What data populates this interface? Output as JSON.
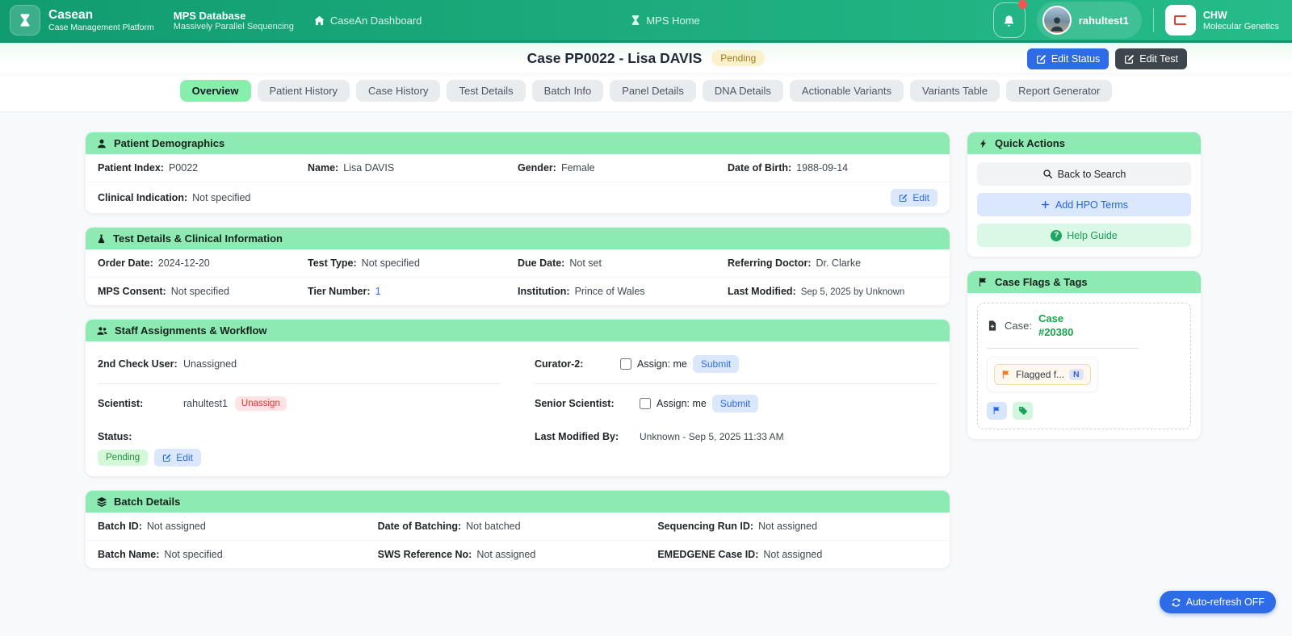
{
  "colors": {
    "brand_green_dark": "#119c6f",
    "brand_green_light": "#27bb8a",
    "header_green": "#8deab2",
    "active_tab": "#86efac",
    "accent_blue": "#2e6be6",
    "pending_bg": "#fbf2cd",
    "pending_text": "#9a7c1f",
    "danger_red": "#e03131",
    "success_green": "#16a34a"
  },
  "navbar": {
    "brand_title": "Casean",
    "brand_subtitle": "Case Management Platform",
    "mps_title": "MPS Database",
    "mps_subtitle": "Massively Parallel Sequencing",
    "dashboard_link": "CaseAn Dashboard",
    "home_link": "MPS Home",
    "user_name": "rahultest1",
    "org_title": "CHW",
    "org_subtitle": "Molecular Genetics"
  },
  "header": {
    "title": "Case PP0022 - Lisa DAVIS",
    "status": "Pending",
    "edit_status_label": "Edit Status",
    "edit_test_label": "Edit Test"
  },
  "tabs": [
    "Overview",
    "Patient History",
    "Case History",
    "Test Details",
    "Batch Info",
    "Panel Details",
    "DNA Details",
    "Actionable Variants",
    "Variants Table",
    "Report Generator"
  ],
  "demographics": {
    "title": "Patient Demographics",
    "row1": [
      {
        "label": "Patient Index:",
        "value": "P0022"
      },
      {
        "label": "Name:",
        "value": "Lisa DAVIS"
      },
      {
        "label": "Gender:",
        "value": "Female"
      },
      {
        "label": "Date of Birth:",
        "value": "1988-09-14"
      }
    ],
    "row2": {
      "label": "Clinical Indication:",
      "value": "Not specified"
    },
    "edit_label": "Edit"
  },
  "test_details": {
    "title": "Test Details & Clinical Information",
    "row1": [
      {
        "label": "Order Date:",
        "value": "2024-12-20"
      },
      {
        "label": "Test Type:",
        "value": "Not specified"
      },
      {
        "label": "Due Date:",
        "value": "Not set"
      },
      {
        "label": "Referring Doctor:",
        "value": "Dr. Clarke"
      }
    ],
    "row2": [
      {
        "label": "MPS Consent:",
        "value": "Not specified"
      },
      {
        "label": "Tier Number:",
        "value": "1"
      },
      {
        "label": "Institution:",
        "value": "Prince of Wales"
      },
      {
        "label": "Last Modified:",
        "value": "Sep 5, 2025 by Unknown"
      }
    ]
  },
  "staff": {
    "title": "Staff Assignments & Workflow",
    "second_check_label": "2nd Check User:",
    "second_check_value": "Unassigned",
    "curator_label": "Curator-2:",
    "curator_checkbox": "Assign: me",
    "curator_submit": "Submit",
    "scientist_label": "Scientist:",
    "scientist_value": "rahultest1",
    "unassign_label": "Unassign",
    "senior_label": "Senior Scientist:",
    "senior_checkbox": "Assign: me",
    "senior_submit": "Submit",
    "status_label": "Status:",
    "status_value": "Pending",
    "status_edit": "Edit",
    "last_modified_label": "Last Modified By:",
    "last_modified_value": "Unknown - Sep 5, 2025 11:33 AM"
  },
  "batch": {
    "title": "Batch Details",
    "row1": [
      {
        "label": "Batch ID:",
        "value": "Not assigned"
      },
      {
        "label": "Date of Batching:",
        "value": "Not batched"
      },
      {
        "label": "Sequencing Run ID:",
        "value": "Not assigned"
      }
    ],
    "row2": [
      {
        "label": "Batch Name:",
        "value": "Not specified"
      },
      {
        "label": "SWS Reference No:",
        "value": "Not assigned"
      },
      {
        "label": "EMEDGENE Case ID:",
        "value": "Not assigned"
      }
    ]
  },
  "quick_actions": {
    "title": "Quick Actions",
    "back_label": "Back to Search",
    "hpo_label": "Add HPO Terms",
    "help_label": "Help Guide"
  },
  "flags": {
    "title": "Case Flags & Tags",
    "case_label": "Case:",
    "case_value": "Case #20380",
    "chip_label": "Flagged f...",
    "chip_badge": "N"
  },
  "footer": {
    "auto_refresh_label": "Auto-refresh OFF"
  }
}
